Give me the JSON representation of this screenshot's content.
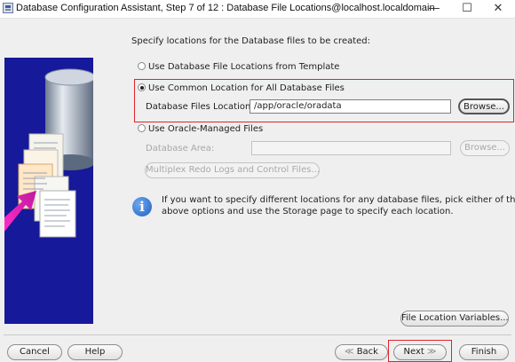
{
  "window": {
    "title": "Database Configuration Assistant, Step 7 of 12 : Database File Locations@localhost.localdomain",
    "minimize_glyph": "—",
    "maximize_glyph": "☐",
    "close_glyph": "✕"
  },
  "main": {
    "heading": "Specify locations for the Database files to be created:",
    "options": [
      {
        "label": "Use Database File Locations from Template",
        "selected": false,
        "enabled": true
      },
      {
        "label": "Use Common Location for All Database Files",
        "selected": true,
        "enabled": true
      },
      {
        "label": "Use Oracle-Managed Files",
        "selected": false,
        "enabled": true
      }
    ],
    "common_location": {
      "label": "Database Files Location:",
      "value": "/app/oracle/oradata",
      "browse_label": "Browse..."
    },
    "managed_files": {
      "area_label": "Database Area:",
      "area_value": "",
      "browse_label": "Browse...",
      "multiplex_label": "Multiplex Redo Logs and Control Files..."
    },
    "info_text_line1": "If you want to specify different locations for any database files, pick either of the",
    "info_text_line2": "above options and use the Storage page to specify each location.",
    "file_location_variables_label": "File Location Variables..."
  },
  "footer": {
    "cancel": "Cancel",
    "help": "Help",
    "back": "Back",
    "next": "Next",
    "finish": "Finish"
  },
  "colors": {
    "highlight_border": "#e0242c",
    "graphic_background": "#16199a"
  },
  "icons": [
    "app-icon",
    "database-cylinder-icon",
    "document-stack-icon",
    "arrow-icon",
    "info-icon"
  ]
}
